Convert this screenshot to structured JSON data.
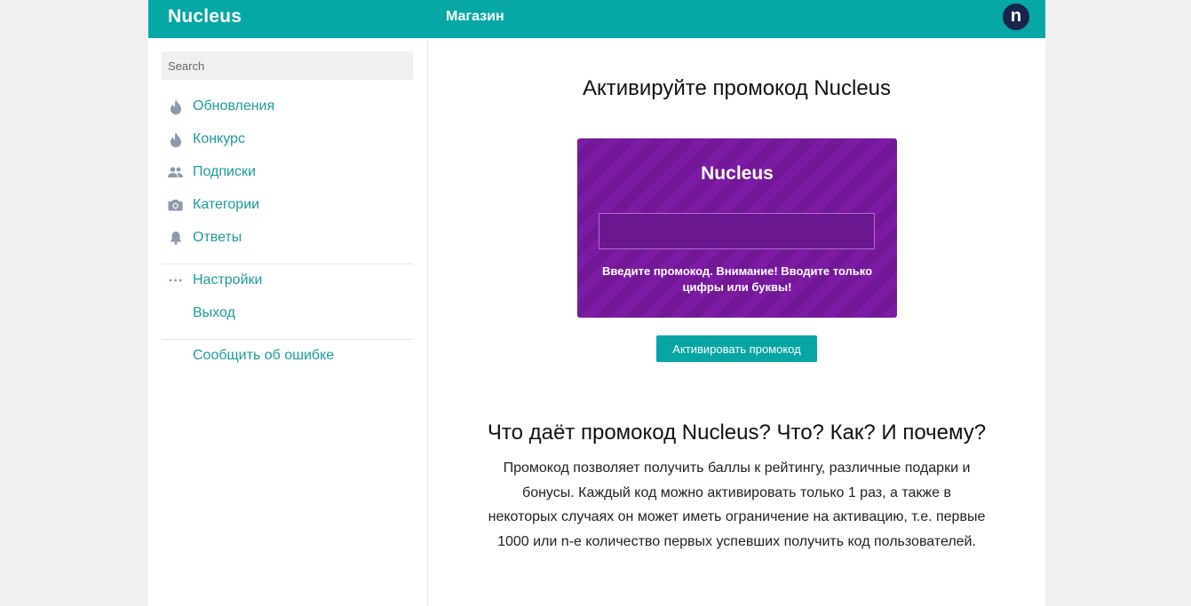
{
  "header": {
    "brand": "Nucleus",
    "nav_shop": "Магазин",
    "avatar_letter": "n"
  },
  "sidebar": {
    "search_placeholder": "Search",
    "items": [
      {
        "label": "Обновления",
        "icon": "flame-icon"
      },
      {
        "label": "Конкурс",
        "icon": "flame-icon"
      },
      {
        "label": "Подписки",
        "icon": "people-icon"
      },
      {
        "label": "Категории",
        "icon": "camera-icon"
      },
      {
        "label": "Ответы",
        "icon": "bell-icon"
      }
    ],
    "settings": {
      "label": "Настройки",
      "icon": "more-dots-icon"
    },
    "logout": {
      "label": "Выход"
    },
    "report": {
      "label": "Сообщить об ошибке"
    }
  },
  "main": {
    "title": "Активируйте промокод Nucleus",
    "card": {
      "title": "Nucleus",
      "input_value": "",
      "hint": "Введите промокод. Внимание! Вводите только цифры или буквы!"
    },
    "activate_button": "Активировать промокод",
    "info_title": "Что даёт промокод Nucleus? Что? Как? И почему?",
    "info_text": "Промокод позволяет получить баллы к рейтингу, различные подарки и бонусы. Каждый код можно активировать только 1 раз, а также в некоторых случаях он может иметь ограничение на активацию, т.е. первые 1000 или n-е количество первых успевших получить код пользователей."
  },
  "colors": {
    "accent": "#06a7a5",
    "link": "#1f9a9a",
    "card_purple": "#7c1aa3",
    "avatar_bg": "#17254a",
    "icon_gray": "#8a9aac"
  }
}
